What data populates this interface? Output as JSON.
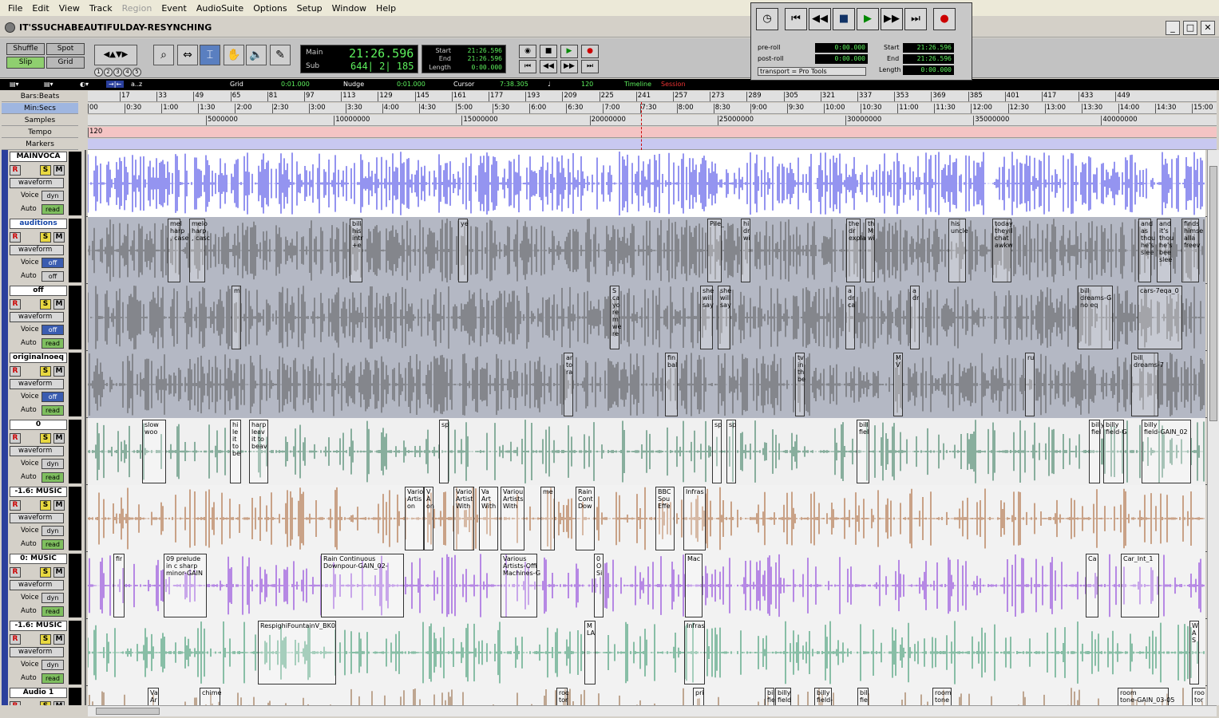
{
  "menu": {
    "items": [
      "File",
      "Edit",
      "View",
      "Track",
      "Region",
      "Event",
      "AudioSuite",
      "Options",
      "Setup",
      "Window",
      "Help"
    ]
  },
  "window": {
    "title": "IT'SSUCHABEAUTIFULDAY-RESYNCHING"
  },
  "modes": {
    "shuffle": "Shuffle",
    "spot": "Spot",
    "slip": "Slip",
    "grid": "Grid"
  },
  "zoom_presets": [
    "1",
    "2",
    "3",
    "4",
    "5"
  ],
  "counter": {
    "main_label": "Main",
    "main_value": "21:26.596",
    "sub_label": "Sub",
    "sub_value": "644| 2| 185"
  },
  "selection": {
    "start_label": "Start",
    "start": "21:26.596",
    "end_label": "End",
    "end": "21:26.596",
    "length_label": "Length",
    "length": "0:00.000"
  },
  "edit_bar": {
    "grid_label": "Grid",
    "grid_value": "0:01.000",
    "nudge_label": "Nudge",
    "nudge_value": "0:01.000",
    "cursor_label": "Cursor",
    "cursor_value": "7:38.305",
    "tempo": "120",
    "timeline": "Timeline",
    "session": "Session",
    "az": "a..z"
  },
  "transport_window": {
    "preroll_label": "pre-roll",
    "preroll": "0:00.000",
    "postroll_label": "post-roll",
    "postroll": "0:00.000",
    "transport_label": "transport = Pro Tools",
    "start_label": "Start",
    "start": "21:26.596",
    "end_label": "End",
    "end": "21:26.596",
    "length_label": "Length",
    "length": "0:00.000"
  },
  "rulers": {
    "labels": [
      "Bars:Beats",
      "Min:Secs",
      "Samples",
      "Tempo",
      "Markers"
    ],
    "bars": [
      "17",
      "33",
      "49",
      "65",
      "81",
      "97",
      "113",
      "129",
      "145",
      "161",
      "177",
      "193",
      "209",
      "225",
      "241",
      "257",
      "273",
      "289",
      "305",
      "321",
      "337",
      "353",
      "369",
      "385",
      "401",
      "417",
      "433",
      "449"
    ],
    "minsecs": [
      "00",
      "0:30",
      "1:00",
      "1:30",
      "2:00",
      "2:30",
      "3:00",
      "3:30",
      "4:00",
      "4:30",
      "5:00",
      "5:30",
      "6:00",
      "6:30",
      "7:00",
      "7:30",
      "8:00",
      "8:30",
      "9:00",
      "9:30",
      "10:00",
      "10:30",
      "11:00",
      "11:30",
      "12:00",
      "12:30",
      "13:00",
      "13:30",
      "14:00",
      "14:30",
      "15:00"
    ],
    "samples": [
      "5000000",
      "10000000",
      "15000000",
      "20000000",
      "25000000",
      "30000000",
      "35000000",
      "40000000"
    ],
    "tempo_value": "120"
  },
  "tracks": [
    {
      "name": "MAINVOCA",
      "view": "waveform",
      "vol_label": "Voice",
      "vol": "dyn",
      "auto_label": "Auto",
      "auto": "read",
      "bg": "#ffffff",
      "wave": "#2a2ae0",
      "labels": []
    },
    {
      "name": "auditions",
      "view": "waveform",
      "vol_label": "Voice",
      "vol": "off",
      "auto_label": "Auto",
      "auto": "off",
      "bg": "#b4b8c4",
      "wave": "#555555",
      "labels": [
        {
          "t": "mel\nharp\n, case"
        },
        {
          "t": "melo\nharp\n, casc"
        },
        {
          "t": "bill\nhis\nintr\n+e"
        },
        {
          "t": "ye"
        },
        {
          "t": "Pile_"
        },
        {
          "t": "hi\ndr\nwi"
        },
        {
          "t": "the\ndr\nexpla"
        },
        {
          "t": "th\nM\nwi"
        },
        {
          "t": "his\nuncle"
        },
        {
          "t": "today\ntheyll\nchat\nawkw"
        },
        {
          "t": "and\nas\nthou\nhe's\nslee"
        },
        {
          "t": "and\nit's\nthou\nhe's\nbee\nslee"
        },
        {
          "t": "finds\nhimse\nalla\nfreev"
        }
      ]
    },
    {
      "name": "off",
      "view": "waveform",
      "vol_label": "Voice",
      "vol": "off",
      "auto_label": "Auto",
      "auto": "read",
      "bg": "#b4b8c4",
      "wave": "#555555",
      "labels": [
        {
          "t": "m"
        },
        {
          "t": "S\nca\nyo\nre\nm\nwe\nre"
        },
        {
          "t": "she\nwill\nsay"
        },
        {
          "t": "she\nwill\nsay"
        },
        {
          "t": "a\ndr\nca"
        },
        {
          "t": "a\ndr"
        },
        {
          "t": "bill\ndreams-G\nno eq"
        },
        {
          "t": "cars-7eqa_0"
        }
      ]
    },
    {
      "name": "originalnoeq",
      "view": "waveform",
      "vol_label": "Voice",
      "vol": "off",
      "auto_label": "Auto",
      "auto": "read",
      "bg": "#b4b8c4",
      "wave": "#555555",
      "labels": [
        {
          "t": "ar\nto\nra"
        },
        {
          "t": "fin\nbal"
        },
        {
          "t": "tv\nin\nth\nbe"
        },
        {
          "t": "M\nV"
        },
        {
          "t": "ru"
        },
        {
          "t": "bill\ndreams-7"
        }
      ]
    },
    {
      "name": "0",
      "view": "waveform",
      "vol_label": "Voice",
      "vol": "dyn",
      "auto_label": "Auto",
      "auto": "read",
      "bg": "#f0f0f0",
      "wave": "#1f6b4a",
      "labels": [
        {
          "t": "slow\nwoo"
        },
        {
          "t": "hi\nle\nit\nto\nbe"
        },
        {
          "t": "harp\nleav\nit to\nbeav"
        },
        {
          "t": "sp"
        },
        {
          "t": "sp"
        },
        {
          "t": "sp"
        },
        {
          "t": "bill\nfiel"
        },
        {
          "t": "billy\nfiel"
        },
        {
          "t": "billy\nfield-G"
        },
        {
          "t": "billy\nfield-GAIN_02"
        }
      ]
    },
    {
      "name": "-1.6: MUSIC",
      "view": "waveform",
      "vol_label": "Voice",
      "vol": "dyn",
      "auto_label": "Auto",
      "auto": "read",
      "bg": "#f2f2f2",
      "wave": "#a0521c",
      "labels": [
        {
          "t": "Vario\nArtis\non"
        },
        {
          "t": "V\nA\non"
        },
        {
          "t": "Vario\nArtist\nWith"
        },
        {
          "t": "Va\nArt\nWith"
        },
        {
          "t": "Variou\nArtists\nWith"
        },
        {
          "t": "me"
        },
        {
          "t": "Rain\nCont\nDow"
        },
        {
          "t": "BBC\nSou\nEffe"
        },
        {
          "t": "Infras"
        }
      ]
    },
    {
      "name": "0: MUSIC",
      "view": "waveform",
      "vol_label": "Voice",
      "vol": "dyn",
      "auto_label": "Auto",
      "auto": "read",
      "bg": "#f2f2f2",
      "wave": "#7a1fd6",
      "labels": [
        {
          "t": "fir"
        },
        {
          "t": "09 prelude\nin c sharp\nminor-GAIN"
        },
        {
          "t": "Rain Continuous\nDownpour-GAIN_02-"
        },
        {
          "t": "Various\nArtists-Offi\nMachines-G"
        },
        {
          "t": "0\nO\nSi"
        },
        {
          "t": "Mac"
        },
        {
          "t": "Ca"
        },
        {
          "t": "Car_Int_1"
        }
      ]
    },
    {
      "name": "-1.6: MUSIC",
      "view": "waveform",
      "vol_label": "Voice",
      "vol": "dyn",
      "auto_label": "Auto",
      "auto": "read",
      "bg": "#f2f2f2",
      "wave": "#1f8a5a",
      "labels": [
        {
          "t": "RespighiFountainV_BK0"
        },
        {
          "t": "M\nLA"
        },
        {
          "t": "Infras"
        },
        {
          "t": "W\nA\nS"
        }
      ]
    },
    {
      "name": "Audio 1",
      "view": "waveform",
      "vol_label": "Voice",
      "vol": "dyn",
      "auto_label": "Auto",
      "auto": "read",
      "bg": "#f2f2f2",
      "wave": "#8a5a30",
      "labels": [
        {
          "t": "Va\nAr"
        },
        {
          "t": "chime"
        },
        {
          "t": "roc\ntor"
        },
        {
          "t": "pri"
        },
        {
          "t": "bill\nfie"
        },
        {
          "t": "billy\nfield"
        },
        {
          "t": "billy\nfield-"
        },
        {
          "t": "bill\nfie"
        },
        {
          "t": "room\ntone"
        },
        {
          "t": "room\ntone-GAIN_03-05"
        },
        {
          "t": "roo\ntor"
        }
      ]
    }
  ],
  "colors": {
    "track_color": "#2b3f9c",
    "counter_green": "#5df05d",
    "tempo_ruler": "#f4c4c4",
    "markers_ruler": "#c8c8f0"
  }
}
